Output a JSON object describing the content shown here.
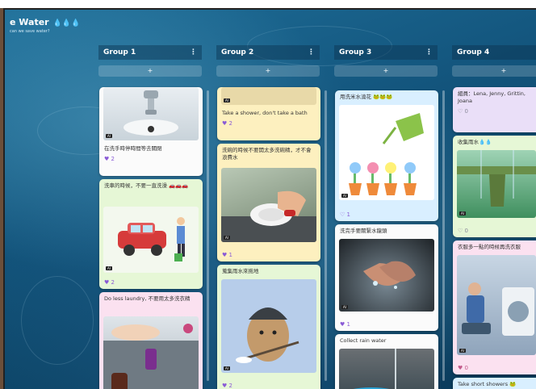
{
  "header": {
    "title": "e Water",
    "drops": "💧💧💧",
    "subtitle": "can we save water?"
  },
  "columns": [
    {
      "name": "Group 1",
      "more": "⋮",
      "add": "+",
      "cards": [
        {
          "title": "在洗手時停時間等去關閉",
          "likes": "♥ 2",
          "badge": "AI"
        },
        {
          "title": "洗車的時候，不要一直洗澡 🚗🚗🚗",
          "likes": "♥ 2",
          "badge": "AI"
        },
        {
          "title": "Do less laundry, 不要用太多洗衣精",
          "likes": "",
          "badge": ""
        }
      ]
    },
    {
      "name": "Group 2",
      "more": "⋮",
      "add": "+",
      "cards": [
        {
          "title": "Take a shower, don't take a bath",
          "likes": "♥ 2",
          "badge": "AI"
        },
        {
          "title": "洗碗的時候不要開太多洗碗精，才不會浪費水",
          "likes": "♥ 1",
          "badge": "AI"
        },
        {
          "title": "蒐集雨水來拖地",
          "likes": "♥ 2",
          "badge": "AI"
        }
      ]
    },
    {
      "name": "Group 3",
      "more": "⋮",
      "add": "+",
      "cards": [
        {
          "title": "用洗米水澆花 🐸🐸🐸",
          "likes": "♡ 1",
          "badge": "AI"
        },
        {
          "title": "洗完手要關緊水龍頭",
          "likes": "♥ 1",
          "badge": "AI"
        },
        {
          "title": "Collect rain water",
          "likes": "",
          "badge": ""
        }
      ]
    },
    {
      "name": "Group 4",
      "more": "⋮",
      "add": "+",
      "cards": [
        {
          "title": "組員：Lena, Jenny, Grittin, Joana",
          "likes": "♡ 0",
          "badge": ""
        },
        {
          "title": "收集雨水💧💧",
          "likes": "♡ 0",
          "badge": "AI"
        },
        {
          "title": "衣服多一點的時候再洗衣服",
          "likes": "♥ 0",
          "badge": "AI"
        },
        {
          "title": "Take short showers 🐸",
          "likes": "",
          "badge": ""
        }
      ]
    }
  ]
}
